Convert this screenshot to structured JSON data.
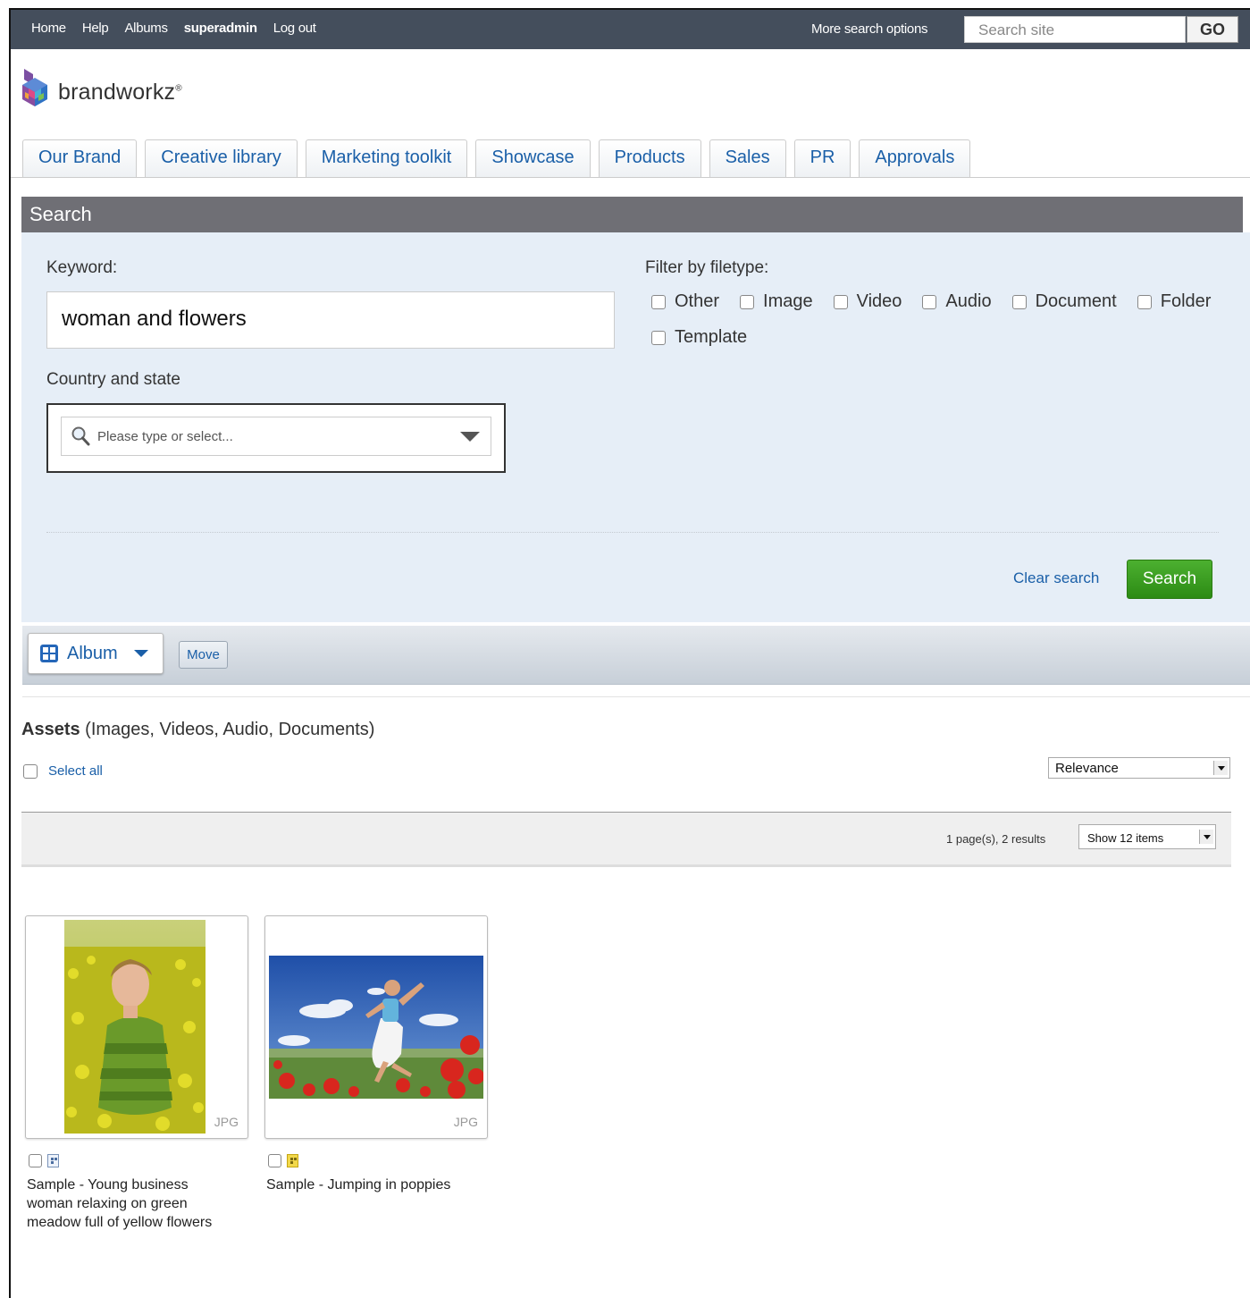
{
  "topbar": {
    "nav": [
      "Home",
      "Help",
      "Albums",
      "superadmin",
      "Log out"
    ],
    "more_search": "More search options",
    "search_placeholder": "Search site",
    "go_label": "GO"
  },
  "brand": {
    "name": "brandworkz",
    "mark": "®"
  },
  "tabs": [
    "Our Brand",
    "Creative library",
    "Marketing toolkit",
    "Showcase",
    "Products",
    "Sales",
    "PR",
    "Approvals"
  ],
  "search": {
    "header": "Search",
    "keyword_label": "Keyword:",
    "keyword_value": "woman and flowers",
    "country_label": "Country and state",
    "country_placeholder": "Please type or select...",
    "filter_label": "Filter by filetype:",
    "filetypes": [
      "Other",
      "Image",
      "Video",
      "Audio",
      "Document",
      "Folder",
      "Template"
    ],
    "clear_label": "Clear search",
    "search_label": "Search"
  },
  "toolbar": {
    "album_label": "Album",
    "move_label": "Move"
  },
  "assets": {
    "title_bold": "Assets",
    "title_rest": "(Images, Videos, Audio, Documents)",
    "select_all": "Select all",
    "sort_value": "Relevance",
    "results": "1 page(s), 2 results",
    "show_value": "Show 12 items",
    "items": [
      {
        "type": "JPG",
        "caption": "Sample - Young business woman relaxing on green meadow full of yellow flowers"
      },
      {
        "type": "JPG",
        "caption": "Sample - Jumping in poppies"
      }
    ]
  },
  "colors": {
    "topbar": "#444e5c",
    "link": "#1a5fa8",
    "panel": "#e6eef7",
    "search_header": "#6f6f75",
    "search_button": "#3a9d22"
  },
  "icons": [
    "search-icon",
    "dropdown-arrow-icon",
    "album-grid-icon",
    "chevron-down-icon",
    "image-type-icon"
  ]
}
